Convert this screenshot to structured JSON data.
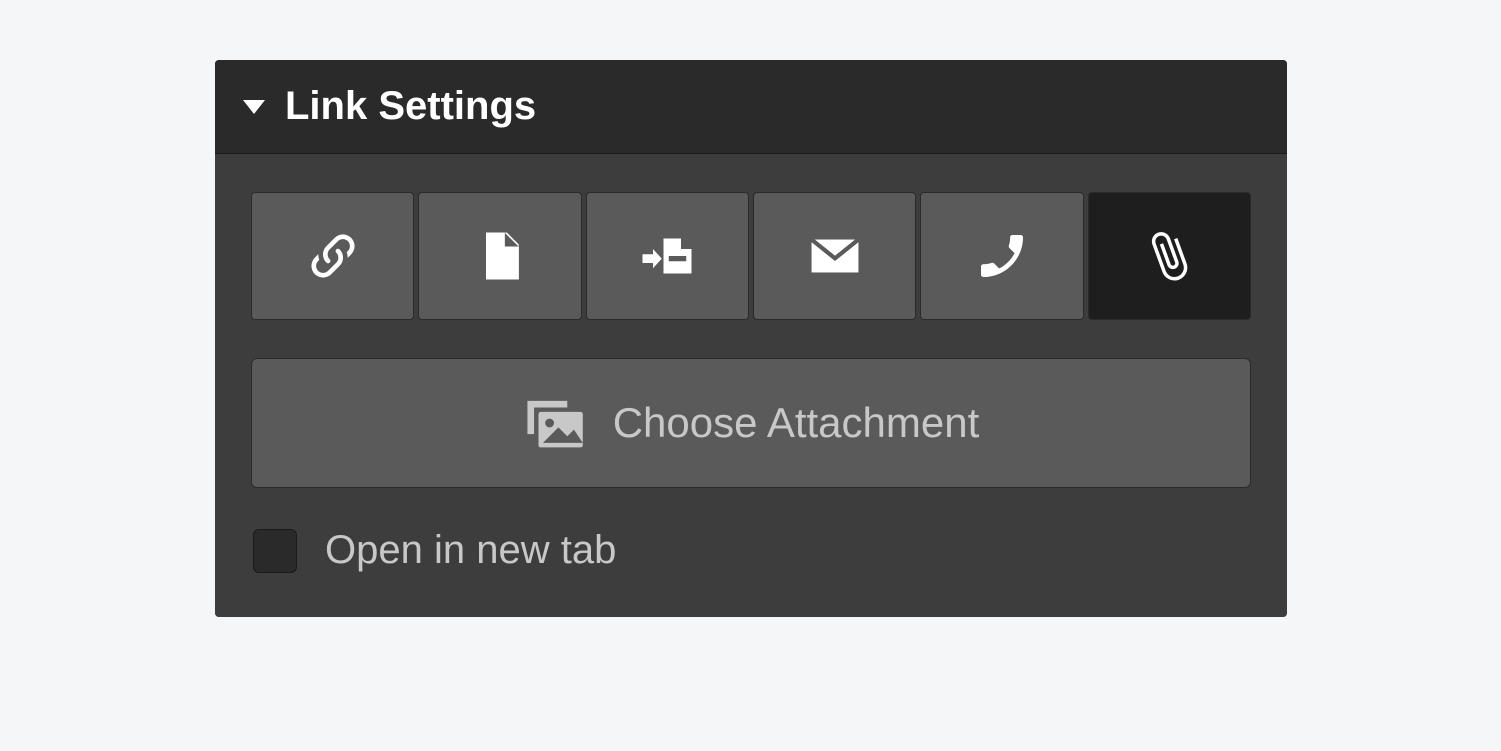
{
  "panel": {
    "title": "Link Settings",
    "linkTypes": [
      {
        "name": "url",
        "icon": "link-icon",
        "active": false
      },
      {
        "name": "page",
        "icon": "page-icon",
        "active": false
      },
      {
        "name": "import-page",
        "icon": "import-page-icon",
        "active": false
      },
      {
        "name": "email",
        "icon": "email-icon",
        "active": false
      },
      {
        "name": "phone",
        "icon": "phone-icon",
        "active": false
      },
      {
        "name": "attachment",
        "icon": "attachment-icon",
        "active": true
      }
    ],
    "chooseAttachmentLabel": "Choose Attachment",
    "openInNewTab": {
      "label": "Open in new tab",
      "checked": false
    }
  }
}
